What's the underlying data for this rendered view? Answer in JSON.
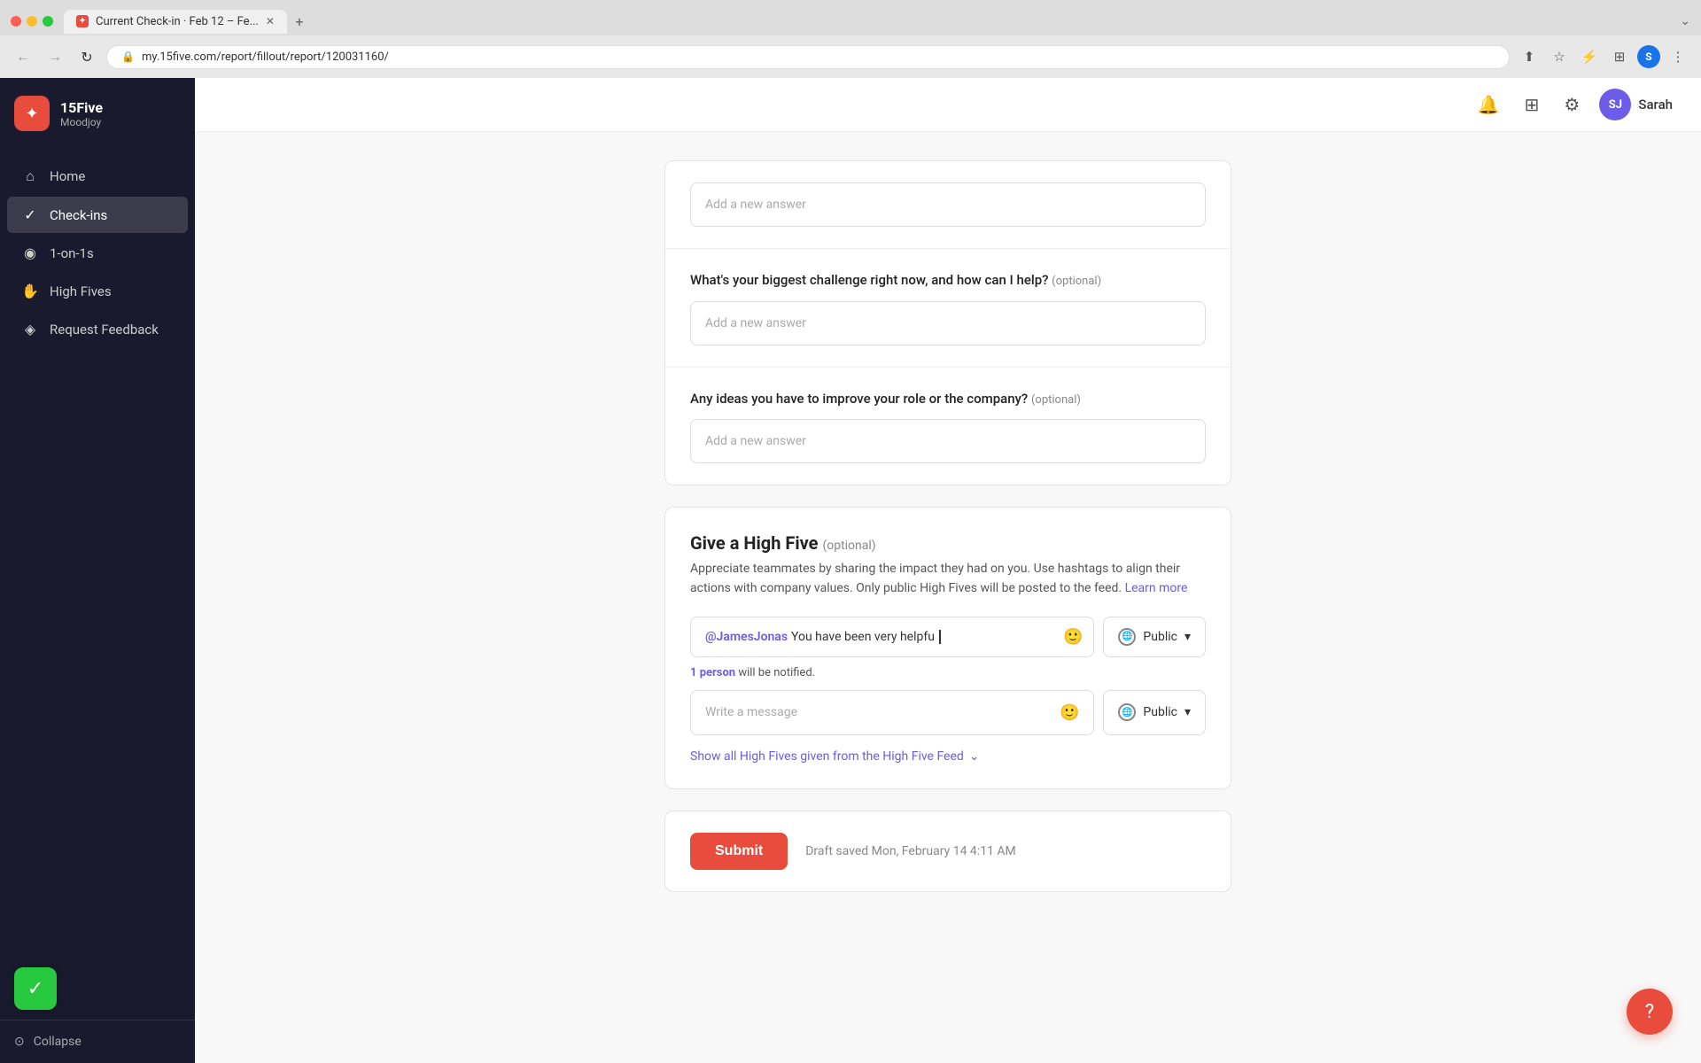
{
  "browser": {
    "tab_title": "Current Check-in · Feb 12 – Fe...",
    "url": "my.15five.com/report/fillout/report/120031160/",
    "favicon_text": "✦"
  },
  "sidebar": {
    "brand_name": "15Five",
    "brand_sub": "Moodjoy",
    "items": [
      {
        "id": "home",
        "label": "Home",
        "icon": "⌂",
        "active": false
      },
      {
        "id": "checkins",
        "label": "Check-ins",
        "icon": "✓",
        "active": true
      },
      {
        "id": "one-on-ones",
        "label": "1-on-1s",
        "icon": "◉",
        "active": false
      },
      {
        "id": "high-fives",
        "label": "High Fives",
        "icon": "✋",
        "active": false
      },
      {
        "id": "request-feedback",
        "label": "Request Feedback",
        "icon": "◈",
        "active": false
      }
    ],
    "collapse_label": "Collapse"
  },
  "topbar": {
    "user_initials": "SJ",
    "user_name": "Sarah"
  },
  "main": {
    "questions": [
      {
        "id": "q1",
        "label": "",
        "optional": false,
        "placeholder": "Add a new answer"
      },
      {
        "id": "q2",
        "label": "What's your biggest challenge right now, and how can I help?",
        "optional": true,
        "placeholder": "Add a new answer"
      },
      {
        "id": "q3",
        "label": "Any ideas you have to improve your role or the company?",
        "optional": true,
        "placeholder": "Add a new answer"
      }
    ],
    "high_five": {
      "title": "Give a High Five",
      "optional_tag": "(optional)",
      "description": "Appreciate teammates by sharing the impact they had on you. Use hashtags to align their actions with company values. Only public High Fives will be posted to the feed.",
      "learn_more": "Learn more",
      "message_text": "@JamesJonas You have been very helpfu",
      "mention": "@JamesJonas",
      "message_body": " You have been very helpfu",
      "visibility_label": "Public",
      "notify_text": "1 person",
      "notify_suffix": " will be notified.",
      "write_placeholder": "Write a message",
      "show_all_label": "Show all High Fives given from the High Five Feed"
    },
    "submit": {
      "button_label": "Submit",
      "draft_text": "Draft saved Mon, February 14 4:11 AM"
    }
  }
}
